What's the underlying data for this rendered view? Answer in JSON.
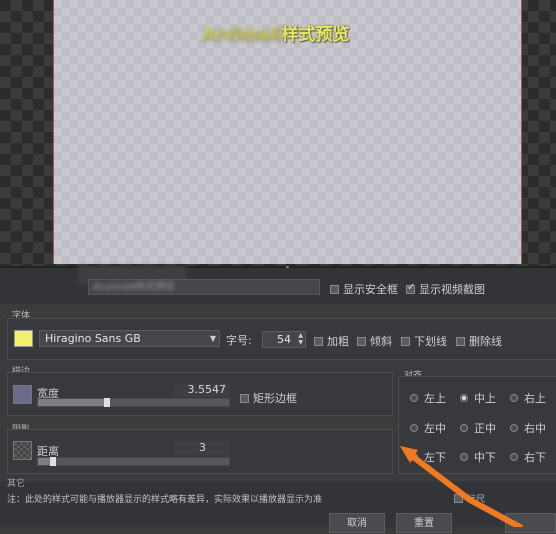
{
  "preview": {
    "title_blurred": "Arvima6",
    "title": "样式预览"
  },
  "top_row": {
    "name_value": "Arvima6样式预览",
    "safe_frame_label": "显示安全框",
    "show_frame_label": "显示视频截图",
    "safe_frame_checked": false,
    "show_frame_checked": true
  },
  "font": {
    "group_label": "字体",
    "color": "#f1f06a",
    "family": "Hiragino Sans GB",
    "size_label": "字号:",
    "size_value": "54",
    "bold_label": "加粗",
    "italic_label": "倾斜",
    "underline_label": "下划线",
    "strike_label": "删除线"
  },
  "stroke": {
    "group_label": "描边",
    "color": "#6a6a8a",
    "width_label": "宽度",
    "width_value": "3.5547",
    "width_fraction": 0.36,
    "rect_label": "矩形边框"
  },
  "shadow": {
    "group_label": "阴影",
    "distance_label": "距离",
    "distance_value": "3",
    "distance_fraction": 0.08
  },
  "align": {
    "group_label": "对齐",
    "options": [
      "左上",
      "中上",
      "右上",
      "左中",
      "正中",
      "右中",
      "左下",
      "中下",
      "右下"
    ],
    "selected": "中上"
  },
  "other_label": "其它",
  "note": "注：此处的样式可能与播放器显示的样式略有差异，实际效果以播放器显示为准",
  "ruler_label": "标尺",
  "buttons": {
    "cancel": "取消",
    "reset": "重置"
  },
  "colors": {
    "accent_arrow": "#f07a22"
  }
}
